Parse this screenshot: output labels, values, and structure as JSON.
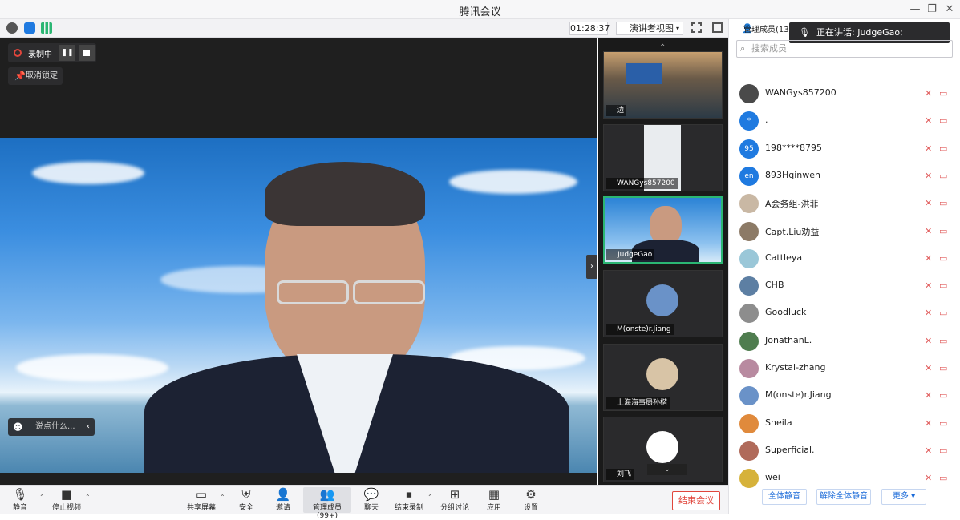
{
  "window": {
    "title": "腾讯会议"
  },
  "toolbar": {
    "timer": "01:28:37",
    "view_label": "演讲者视图",
    "manage_label": "管理成员(130)"
  },
  "speaking": {
    "label": "正在讲话: JudgeGao;"
  },
  "recording": {
    "label": "录制中",
    "unpin": "取消锁定",
    "chat_placeholder": "说点什么..."
  },
  "thumbnails": [
    {
      "name": "边",
      "kind": "room"
    },
    {
      "name": "WANGys857200",
      "kind": "video"
    },
    {
      "name": "JudgeGao",
      "kind": "video-active"
    },
    {
      "name": "M(onste)r.Jiang",
      "kind": "avatar"
    },
    {
      "name": "上海海事局孙楷",
      "kind": "avatar"
    },
    {
      "name": "刘飞",
      "kind": "avatar"
    }
  ],
  "panel": {
    "search_placeholder": "搜索成员",
    "members": [
      {
        "name": "WANGys857200",
        "avatar": "",
        "color": "#4a4a4a"
      },
      {
        "name": ".",
        "avatar": "*",
        "color": "#1f7ae0"
      },
      {
        "name": "198****8795",
        "avatar": "95",
        "color": "#1f7ae0"
      },
      {
        "name": "893Hqinwen",
        "avatar": "en",
        "color": "#1f7ae0"
      },
      {
        "name": "A会务组-洪菲",
        "avatar": "",
        "color": "#c9b8a4"
      },
      {
        "name": "Capt.Liu劝益",
        "avatar": "",
        "color": "#8c7a66"
      },
      {
        "name": "Cattleya",
        "avatar": "",
        "color": "#9ac7d8"
      },
      {
        "name": "CHB",
        "avatar": "",
        "color": "#5d7fa3"
      },
      {
        "name": "Goodluck",
        "avatar": "",
        "color": "#8d8d8d"
      },
      {
        "name": "JonathanL.",
        "avatar": "",
        "color": "#4f7d4f"
      },
      {
        "name": "Krystal-zhang",
        "avatar": "",
        "color": "#b88aa0"
      },
      {
        "name": "M(onste)r.Jiang",
        "avatar": "",
        "color": "#6a92c8"
      },
      {
        "name": "Sheila",
        "avatar": "",
        "color": "#e08a3c"
      },
      {
        "name": "Superficial.",
        "avatar": "",
        "color": "#b06a5a"
      },
      {
        "name": "wei",
        "avatar": "",
        "color": "#d6b23a"
      }
    ],
    "mute_all": "全体静音",
    "unmute_all": "解除全体静音",
    "more": "更多 ▾"
  },
  "bottombar": {
    "mute": "静音",
    "stop_video": "停止视频",
    "share": "共享屏幕",
    "security": "安全",
    "invite": "邀请",
    "manage": "管理成员(99+)",
    "chat": "聊天",
    "end_record": "结束录制",
    "breakout": "分组讨论",
    "apps": "应用",
    "settings": "设置",
    "end_meeting": "结束会议"
  }
}
